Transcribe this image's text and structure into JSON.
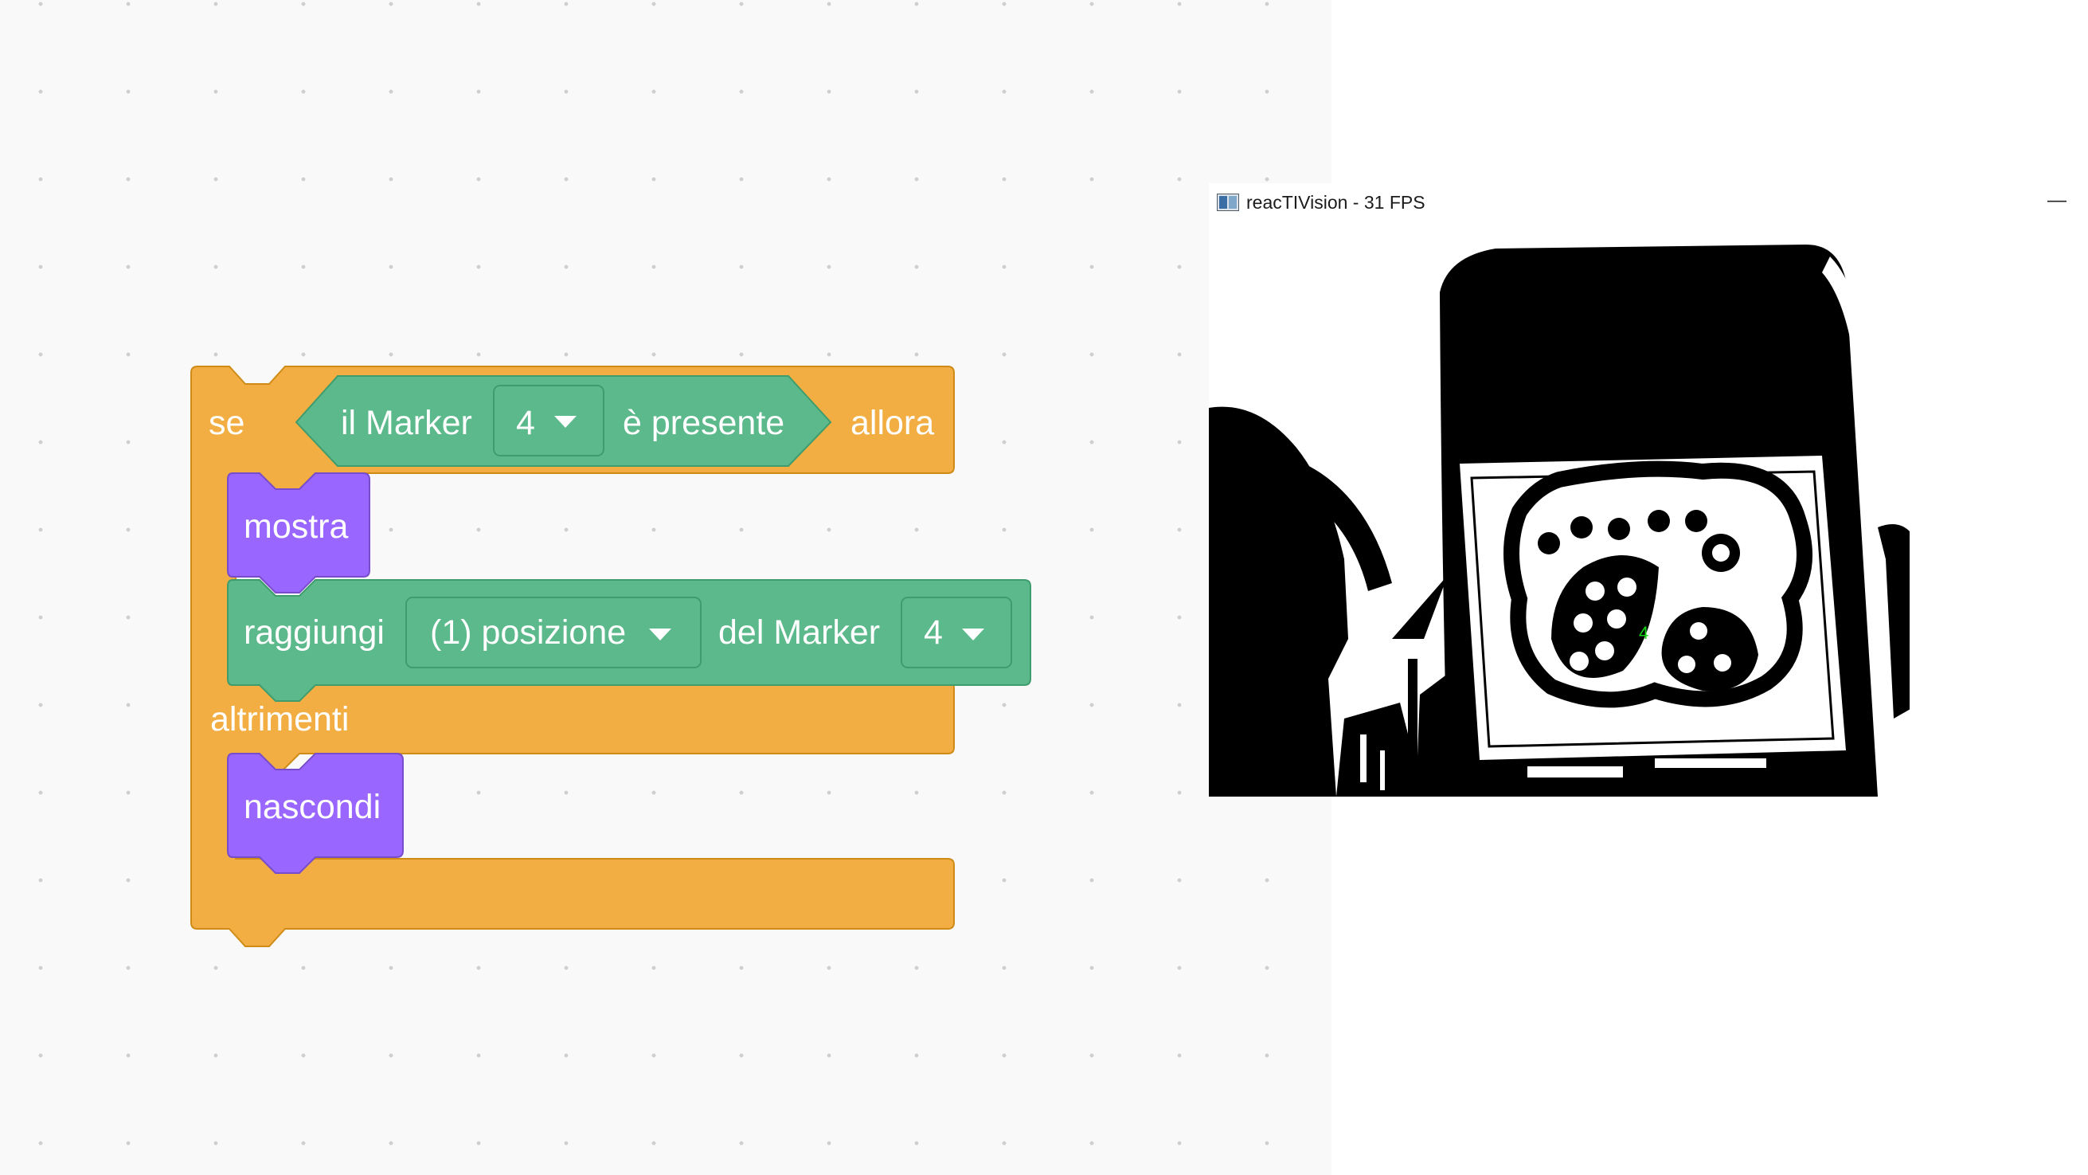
{
  "workspace": {
    "if_else_block": {
      "if_label": "se",
      "then_label": "allora",
      "else_label": "altrimenti",
      "condition": {
        "prefix": "il Marker",
        "marker_value": "4",
        "suffix": "è presente"
      }
    },
    "show_block": {
      "label": "mostra"
    },
    "goto_block": {
      "label": "raggiungi",
      "position_option": "(1) posizione",
      "of_label": "del Marker",
      "marker_value": "4"
    },
    "hide_block": {
      "label": "nascondi"
    }
  },
  "camera_window": {
    "title": "reacTIVision - 31 FPS",
    "minimize_glyph": "—",
    "detected_marker_id": "4"
  },
  "colors": {
    "control": "#f2ae43",
    "control_border": "#cf8b17",
    "sensing": "#5cb98b",
    "sensing_border": "#3f9c6d",
    "looks": "#9966ff",
    "looks_border": "#774dcb"
  }
}
